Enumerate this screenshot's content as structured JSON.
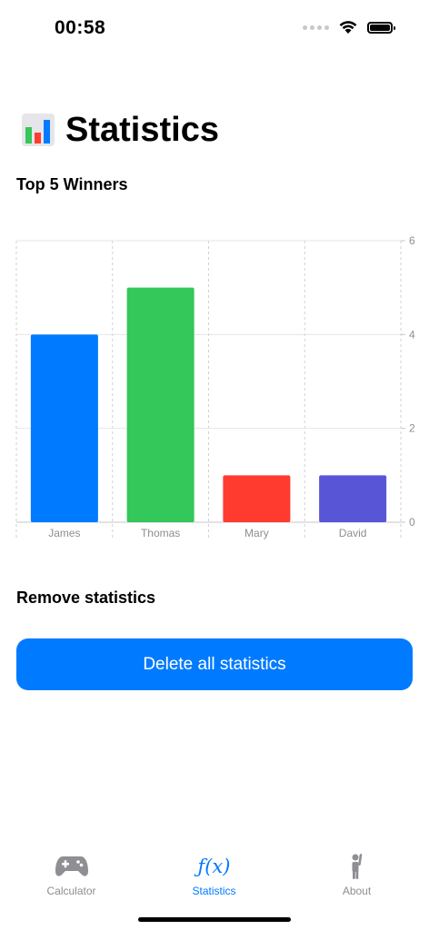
{
  "status_bar": {
    "time": "00:58"
  },
  "header": {
    "title": "Statistics",
    "icon": "bar-chart-emoji-icon"
  },
  "winners_section": {
    "label": "Top 5 Winners"
  },
  "chart_data": {
    "type": "bar",
    "categories": [
      "James",
      "Thomas",
      "Mary",
      "David"
    ],
    "values": [
      4,
      5,
      1,
      1
    ],
    "colors": [
      "#007aff",
      "#34c759",
      "#ff3b30",
      "#5856d6"
    ],
    "ylim": [
      0,
      6
    ],
    "yticks": [
      0,
      2,
      4,
      6
    ],
    "axis_side": "right",
    "grid": true
  },
  "remove_section": {
    "label": "Remove statistics"
  },
  "delete_button": {
    "label": "Delete all statistics"
  },
  "tabs": [
    {
      "label": "Calculator",
      "icon": "gamecontroller-icon",
      "active": false
    },
    {
      "label": "Statistics",
      "icon": "function-fx-icon",
      "icon_text": "ƒ(x)",
      "active": true
    },
    {
      "label": "About",
      "icon": "person-raised-hand-icon",
      "active": false
    }
  ],
  "colors": {
    "accent": "#007aff",
    "tab_inactive": "#8e8e93"
  }
}
